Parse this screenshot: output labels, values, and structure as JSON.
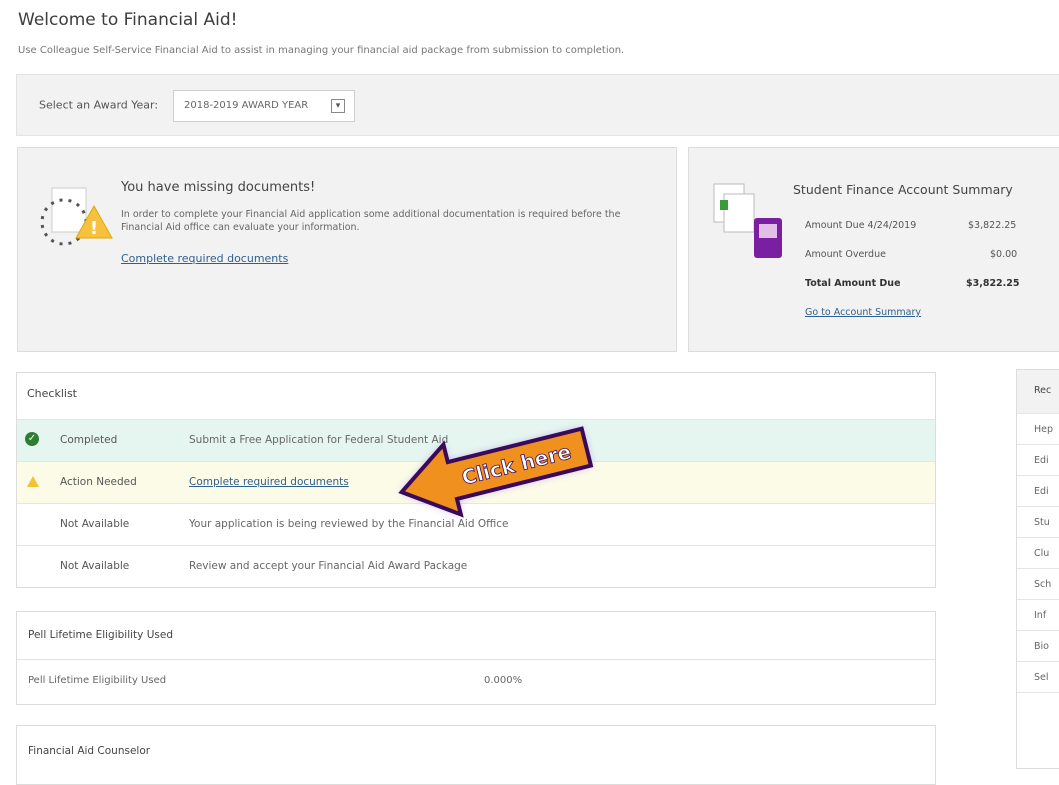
{
  "page": {
    "title": "Welcome to Financial Aid!",
    "subtitle": "Use Colleague Self-Service Financial Aid to assist in managing your financial aid package from submission to completion."
  },
  "award_year": {
    "label": "Select an Award Year:",
    "selected": "2018-2019 AWARD YEAR"
  },
  "missing_docs": {
    "title": "You have missing documents!",
    "description": "In order to complete your Financial Aid application some additional documentation is required before the Financial Aid office can evaluate your information.",
    "link": "Complete required documents"
  },
  "account_summary": {
    "title": "Student Finance Account Summary",
    "rows": [
      {
        "label": "Amount Due 4/24/2019",
        "value": "$3,822.25"
      },
      {
        "label": "Amount Overdue",
        "value": "$0.00"
      },
      {
        "label": "Total Amount Due",
        "value": "$3,822.25"
      }
    ],
    "link": "Go to Account Summary"
  },
  "checklist": {
    "title": "Checklist",
    "items": [
      {
        "status": "Completed",
        "description": "Submit a Free Application for Federal Student Aid",
        "icon": "check-icon"
      },
      {
        "status": "Action Needed",
        "description": "Complete required documents",
        "icon": "warning-icon"
      },
      {
        "status": "Not Available",
        "description": "Your application is being reviewed by the Financial Aid Office"
      },
      {
        "status": "Not Available",
        "description": "Review and accept your Financial Aid Award Package"
      }
    ]
  },
  "callout": {
    "text": "Click here"
  },
  "pell": {
    "title": "Pell Lifetime Eligibility Used",
    "label": "Pell Lifetime Eligibility Used",
    "value": "0.000%"
  },
  "counselor": {
    "title": "Financial Aid Counselor"
  },
  "right_table": {
    "header": "Rec",
    "cells": [
      "Hep",
      "Edi",
      "Edi",
      "Stu",
      "Clu",
      "Sch",
      "Inf",
      "Bio",
      "Sel"
    ]
  },
  "colors": {
    "completed_row": "#e4f6ef",
    "action_row": "#fbfbe8",
    "link": "#2f5f8f",
    "callout_orange": "#f0901e",
    "callout_border": "#3a0a5a"
  }
}
